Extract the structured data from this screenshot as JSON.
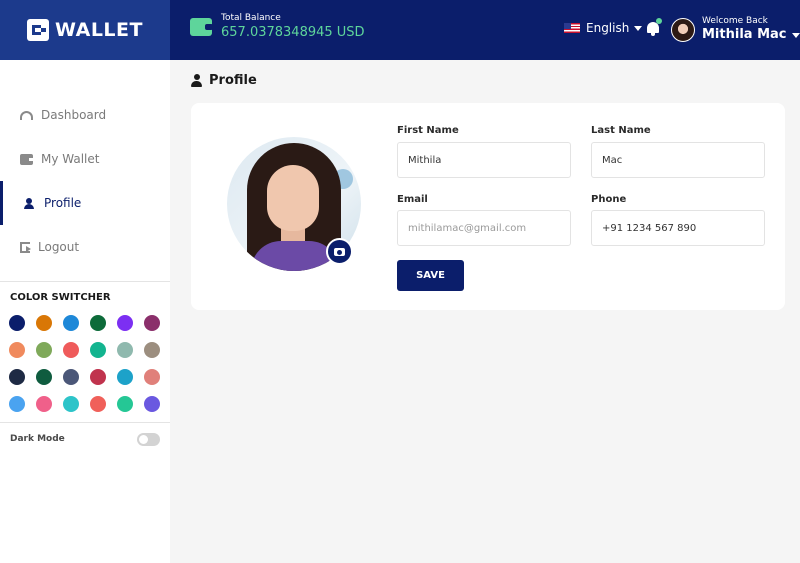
{
  "brand": {
    "name": "WALLET"
  },
  "header": {
    "balance_label": "Total Balance",
    "balance_value": "657.0378348945 USD",
    "language": "English",
    "welcome_text": "Welcome Back",
    "user_name": "Mithila Mac"
  },
  "sidebar": {
    "items": [
      {
        "label": "Dashboard",
        "icon": "dashboard-icon",
        "active": false
      },
      {
        "label": "My Wallet",
        "icon": "wallet-icon",
        "active": false
      },
      {
        "label": "Profile",
        "icon": "user-icon",
        "active": true
      },
      {
        "label": "Logout",
        "icon": "logout-icon",
        "active": false
      }
    ],
    "color_switcher_title": "COLOR SWITCHER",
    "colors": [
      "#0b1e6b",
      "#d97706",
      "#1e88d8",
      "#0d6b3a",
      "#7c2ff2",
      "#8b2f6b",
      "#f08a5d",
      "#7fa95a",
      "#ef5b5b",
      "#13b48f",
      "#8fb9ae",
      "#9c8e7f",
      "#1e2a44",
      "#0f5c3f",
      "#4b5778",
      "#c0334d",
      "#1da2c9",
      "#e0807a",
      "#4aa3f0",
      "#f0608a",
      "#2dc4c9",
      "#f0605a",
      "#25c795",
      "#6a58e0"
    ],
    "dark_mode_label": "Dark Mode",
    "dark_mode_on": false
  },
  "page": {
    "title": "Profile"
  },
  "form": {
    "first_name_label": "First Name",
    "first_name_value": "Mithila",
    "last_name_label": "Last Name",
    "last_name_value": "Mac",
    "email_label": "Email",
    "email_placeholder": "mithilamac@gmail.com",
    "phone_label": "Phone",
    "phone_value": "+91 1234 567 890",
    "save_label": "SAVE"
  },
  "theme": {
    "primary": "#0b1e6b",
    "accent": "#5ed59b"
  }
}
